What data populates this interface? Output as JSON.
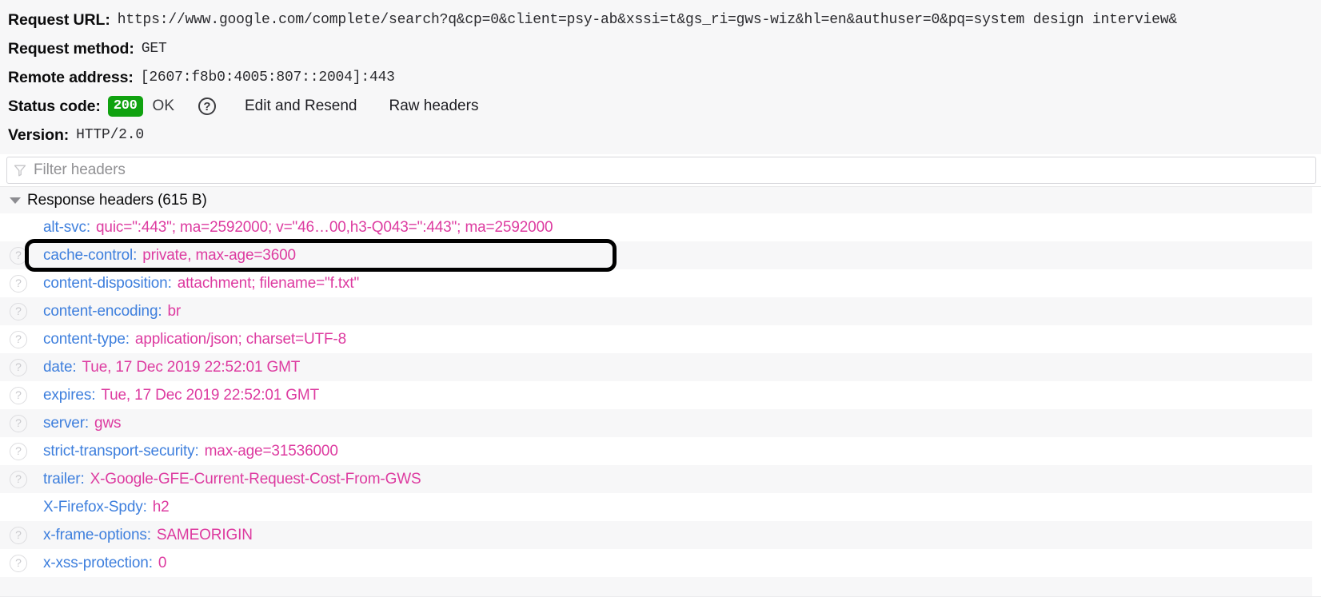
{
  "summary": {
    "request_url_label": "Request URL:",
    "request_url_value": "https://www.google.com/complete/search?q&cp=0&client=psy-ab&xssi=t&gs_ri=gws-wiz&hl=en&authuser=0&pq=system design interview&",
    "request_method_label": "Request method:",
    "request_method_value": "GET",
    "remote_address_label": "Remote address:",
    "remote_address_value": "[2607:f8b0:4005:807::2004]:443",
    "status_code_label": "Status code:",
    "status_code_value": "200",
    "status_text": "OK",
    "status_help_icon": "help-question-icon",
    "edit_resend_label": "Edit and Resend",
    "raw_headers_label": "Raw headers",
    "version_label": "Version:",
    "version_value": "HTTP/2.0",
    "status_badge_color": "#10a210"
  },
  "filter": {
    "placeholder": "Filter headers",
    "value": "",
    "icon": "funnel-filter-icon"
  },
  "headers_group": {
    "label": "Response headers (615 B)",
    "expanded": true,
    "twisty_icon": "chevron-down-icon",
    "rows": [
      {
        "name": "alt-svc",
        "value": "quic=\":443\"; ma=2592000; v=\"46…00,h3-Q043=\":443\"; ma=2592000",
        "has_help": false,
        "highlighted": false
      },
      {
        "name": "cache-control",
        "value": "private, max-age=3600",
        "has_help": true,
        "highlighted": true
      },
      {
        "name": "content-disposition",
        "value": "attachment; filename=\"f.txt\"",
        "has_help": true,
        "highlighted": false
      },
      {
        "name": "content-encoding",
        "value": "br",
        "has_help": true,
        "highlighted": false
      },
      {
        "name": "content-type",
        "value": "application/json; charset=UTF-8",
        "has_help": true,
        "highlighted": false
      },
      {
        "name": "date",
        "value": "Tue, 17 Dec 2019 22:52:01 GMT",
        "has_help": true,
        "highlighted": false
      },
      {
        "name": "expires",
        "value": "Tue, 17 Dec 2019 22:52:01 GMT",
        "has_help": true,
        "highlighted": false
      },
      {
        "name": "server",
        "value": "gws",
        "has_help": true,
        "highlighted": false
      },
      {
        "name": "strict-transport-security",
        "value": "max-age=31536000",
        "has_help": true,
        "highlighted": false
      },
      {
        "name": "trailer",
        "value": "X-Google-GFE-Current-Request-Cost-From-GWS",
        "has_help": true,
        "highlighted": false
      },
      {
        "name": "X-Firefox-Spdy",
        "value": "h2",
        "has_help": false,
        "highlighted": false
      },
      {
        "name": "x-frame-options",
        "value": "SAMEORIGIN",
        "has_help": true,
        "highlighted": false
      },
      {
        "name": "x-xss-protection",
        "value": "0",
        "has_help": true,
        "highlighted": false
      }
    ]
  },
  "colors": {
    "header_name": "#3e7fdd",
    "header_value": "#dd3ba0",
    "annotation": "#000000",
    "panel_bg": "#f7f7f8"
  }
}
